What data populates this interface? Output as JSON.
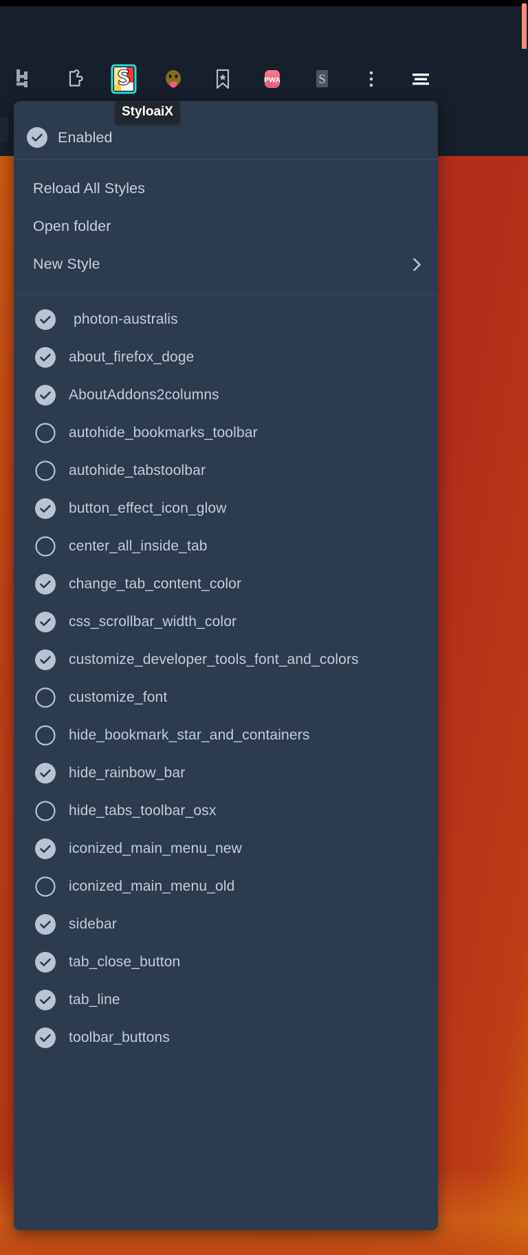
{
  "toolbar": {
    "icons": [
      {
        "name": "tree-style-tab-icon",
        "label": "Tree Style Tab"
      },
      {
        "name": "puzzle-extension-icon",
        "label": "Extensions"
      },
      {
        "name": "styloaix-icon",
        "label": "StyloaiX"
      },
      {
        "name": "tongue-face-icon",
        "label": "Tongue Face"
      },
      {
        "name": "bookmark-star-icon",
        "label": "Bookmark"
      },
      {
        "name": "pwa-icon",
        "label": "PWA"
      },
      {
        "name": "s-letter-icon",
        "label": "S"
      },
      {
        "name": "overflow-menu-icon",
        "label": "More tools"
      },
      {
        "name": "hamburger-menu-icon",
        "label": "Open application menu"
      }
    ]
  },
  "tooltip": {
    "text": "StyloaiX"
  },
  "menu": {
    "enabled": {
      "label": "Enabled",
      "checked": true
    },
    "actions": [
      {
        "label": "Reload All Styles",
        "submenu": false
      },
      {
        "label": "Open folder",
        "submenu": false
      },
      {
        "label": "New Style",
        "submenu": true
      }
    ],
    "submenu_arrow": "›",
    "styles": [
      {
        "label": "photon-australis",
        "checked": true,
        "indented": true
      },
      {
        "label": "about_firefox_doge",
        "checked": true,
        "indented": false
      },
      {
        "label": "AboutAddons2columns",
        "checked": true,
        "indented": false
      },
      {
        "label": "autohide_bookmarks_toolbar",
        "checked": false,
        "indented": false
      },
      {
        "label": "autohide_tabstoolbar",
        "checked": false,
        "indented": false
      },
      {
        "label": "button_effect_icon_glow",
        "checked": true,
        "indented": false
      },
      {
        "label": "center_all_inside_tab",
        "checked": false,
        "indented": false
      },
      {
        "label": "change_tab_content_color",
        "checked": true,
        "indented": false
      },
      {
        "label": "css_scrollbar_width_color",
        "checked": true,
        "indented": false
      },
      {
        "label": "customize_developer_tools_font_and_colors",
        "checked": true,
        "indented": false
      },
      {
        "label": "customize_font",
        "checked": false,
        "indented": false
      },
      {
        "label": "hide_bookmark_star_and_containers",
        "checked": false,
        "indented": false
      },
      {
        "label": "hide_rainbow_bar",
        "checked": true,
        "indented": false
      },
      {
        "label": "hide_tabs_toolbar_osx",
        "checked": false,
        "indented": false
      },
      {
        "label": "iconized_main_menu_new",
        "checked": true,
        "indented": false
      },
      {
        "label": "iconized_main_menu_old",
        "checked": false,
        "indented": false
      },
      {
        "label": "sidebar",
        "checked": true,
        "indented": false
      },
      {
        "label": "tab_close_button",
        "checked": true,
        "indented": false
      },
      {
        "label": "tab_line",
        "checked": true,
        "indented": false
      },
      {
        "label": "toolbar_buttons",
        "checked": true,
        "indented": false
      }
    ]
  },
  "colors": {
    "menu_background": "#2c3b4e",
    "toolbar_background": "#161f2b",
    "menu_text": "#c3ccd8",
    "check_fill": "#b8c4d2",
    "page_background_left": "#d4660c",
    "page_background_right": "#b22d1a",
    "scrollbar_thumb": "#ff8a80",
    "tooltip_background": "#22272e"
  }
}
